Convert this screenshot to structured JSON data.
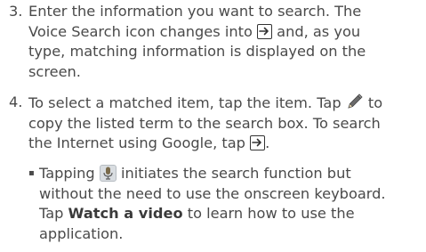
{
  "step3": {
    "number": "3.",
    "line1": "Enter the information you want to search. The",
    "line2_a": "Voice Search icon changes into ",
    "line2_b": " and, as you",
    "line3": "type, matching information is displayed on the",
    "line4": "screen."
  },
  "step4": {
    "number": "4.",
    "line1_a": "To select a matched item, tap the item. Tap ",
    "line1_b": " to",
    "line2": "copy the listed term to the search box. To search",
    "line3_a": "the Internet using Google, tap ",
    "line3_b": "."
  },
  "bullet": {
    "mark": "▪",
    "line1_a": "Tapping ",
    "line1_b": " initiates the search function but",
    "line2": "without the need to use the onscreen keyboard.",
    "line3_a": "Tap ",
    "line3_bold": "Watch a video",
    "line3_b": " to learn how to use the",
    "line4": "application."
  },
  "icons": {
    "arrow": "go-arrow-icon",
    "pencil": "pencil-icon",
    "mic": "microphone-icon"
  }
}
